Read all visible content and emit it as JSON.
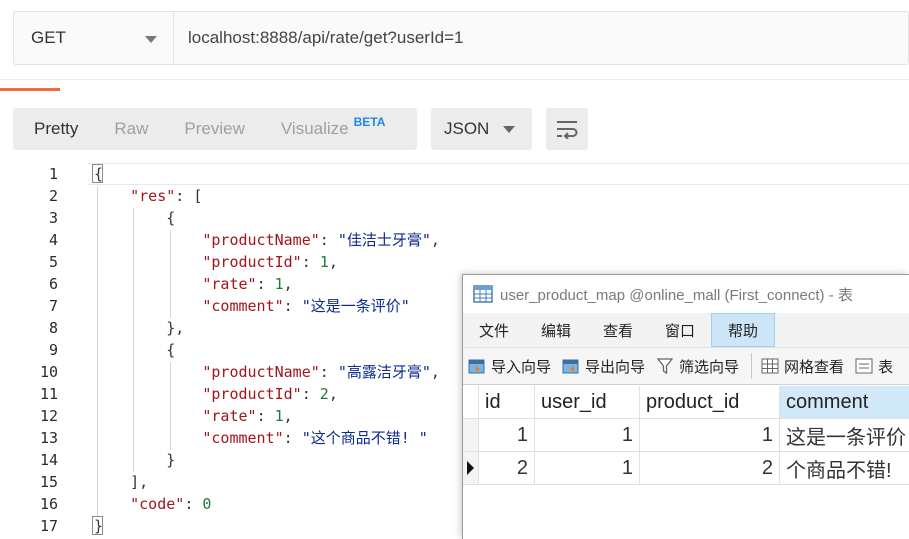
{
  "request": {
    "method": "GET",
    "url": "localhost:8888/api/rate/get?userId=1"
  },
  "response_toolbar": {
    "views": [
      "Pretty",
      "Raw",
      "Preview",
      "Visualize"
    ],
    "beta_badge": "BETA",
    "format": "JSON",
    "wrap_icon": "wrap-lines-icon"
  },
  "code": {
    "line_numbers": [
      "1",
      "2",
      "3",
      "4",
      "5",
      "6",
      "7",
      "8",
      "9",
      "10",
      "11",
      "12",
      "13",
      "14",
      "15",
      "16",
      "17"
    ],
    "json_text": {
      "res_key": "\"res\"",
      "productName_key": "\"productName\"",
      "productId_key": "\"productId\"",
      "rate_key": "\"rate\"",
      "comment_key": "\"comment\"",
      "code_key": "\"code\"",
      "item1_productName": "\"佳洁士牙膏\"",
      "item1_productId": "1",
      "item1_rate": "1",
      "item1_comment": "\"这是一条评价\"",
      "item2_productName": "\"高露洁牙膏\"",
      "item2_productId": "2",
      "item2_rate": "1",
      "item2_comment": "\"这个商品不错! \"",
      "code_value": "0"
    }
  },
  "navicat": {
    "title": "user_product_map @online_mall (First_connect) - 表",
    "menu": [
      "文件",
      "编辑",
      "查看",
      "窗口",
      "帮助"
    ],
    "toolbar": [
      "导入向导",
      "导出向导",
      "筛选向导",
      "网格查看",
      "表"
    ],
    "columns": [
      "id",
      "user_id",
      "product_id",
      "comment"
    ],
    "rows": [
      {
        "id": "1",
        "user_id": "1",
        "product_id": "1",
        "comment": "这是一条评价"
      },
      {
        "id": "2",
        "user_id": "1",
        "product_id": "2",
        "comment": "个商品不错!"
      }
    ],
    "colors": {
      "header_selected": "#d2e9f9",
      "menu_hover": "#cde6f7"
    }
  },
  "colors": {
    "accent": "#f26b3a",
    "json_key": "#a3151b",
    "json_string": "#0b2b8f",
    "json_number": "#1f7a3a"
  }
}
